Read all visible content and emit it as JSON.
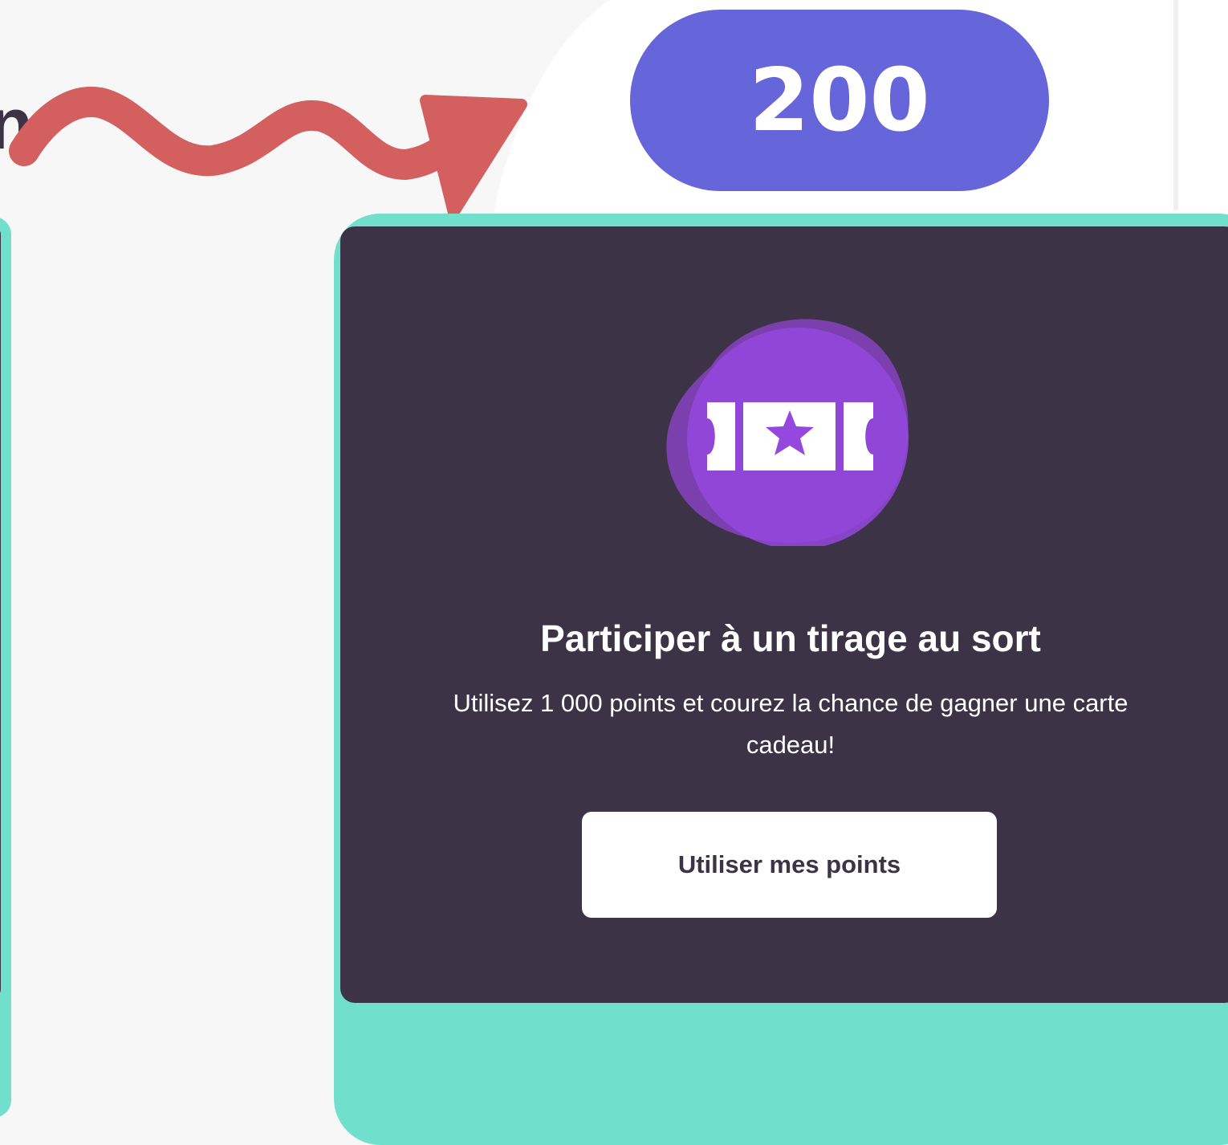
{
  "points_balance": "200",
  "truncated_text": "n",
  "reward_card": {
    "icon": "ticket-star-icon",
    "title": "Participer à un tirage au sort",
    "description": "Utilisez 1 000 points et courez la chance de gagner une carte cadeau!",
    "button_label": "Utiliser mes points"
  },
  "colors": {
    "accent_teal": "#70e0cd",
    "card_dark": "#3c3346",
    "pill_purple": "#6665da",
    "arrow_red": "#d35f5f",
    "icon_purple": "#9448dd"
  }
}
